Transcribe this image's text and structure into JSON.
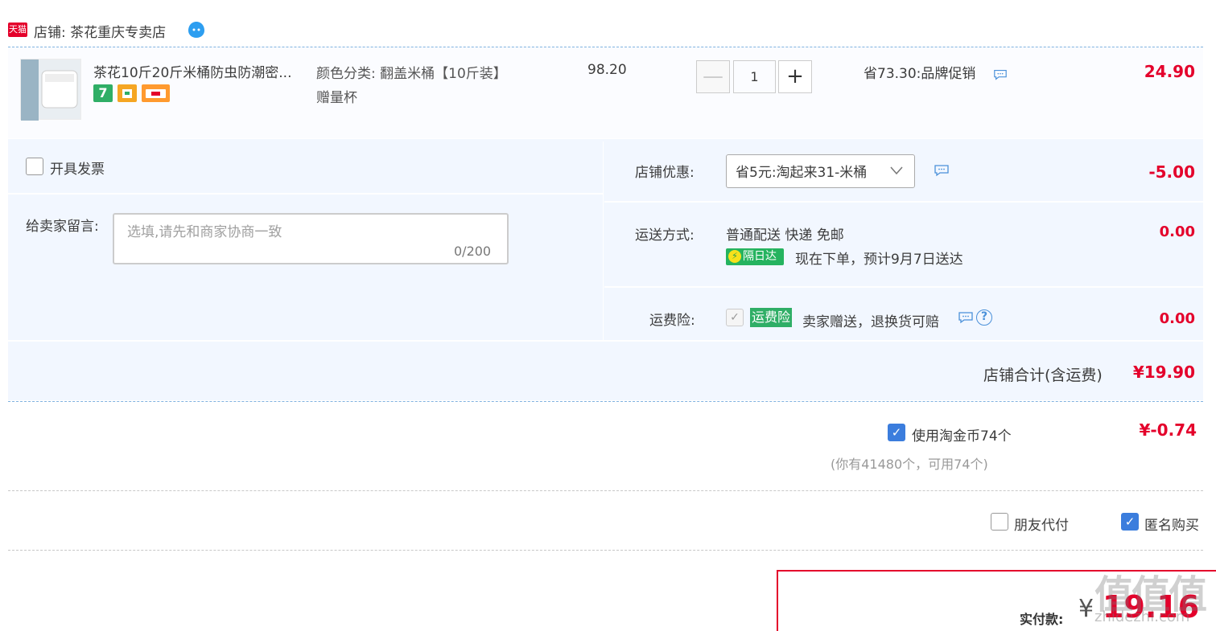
{
  "shop": {
    "badge": "天猫",
    "name": "店铺: 茶花重庆专卖店"
  },
  "item": {
    "title": "茶花10斤20斤米桶防虫防潮密...",
    "tag_seven": "7",
    "sku_line1": "颜色分类: 翻盖米桶【10斤装】",
    "sku_line2": "赠量杯",
    "price": "98.20",
    "quantity": "1",
    "minus": "—",
    "plus": "+",
    "promo": "省73.30:品牌促销",
    "total": "24.90"
  },
  "options": {
    "invoice_label": "开具发票",
    "message_label": "给卖家留言:",
    "message_placeholder": "选填,请先和商家协商一致",
    "message_count": "0/200",
    "coupon_label": "店铺优惠:",
    "coupon_value": "省5元:淘起来31-米桶",
    "coupon_amount": "-5.00",
    "shipping_label": "运送方式:",
    "shipping_value": "普通配送 快递 免邮",
    "express_badge": "隔日达",
    "shipping_eta": "现在下单，预计9月7日送达",
    "shipping_amount": "0.00",
    "insurance_label": "运费险:",
    "insurance_badge": "运费险",
    "insurance_text": "卖家赠送，退换货可赔",
    "insurance_amount": "0.00",
    "shop_total_label": "店铺合计(含运费)",
    "shop_total": "¥19.90"
  },
  "coins": {
    "label": "使用淘金币74个",
    "amount": "¥-0.74",
    "note": "(你有41480个，可用74个)"
  },
  "extras": {
    "friend_pay": "朋友代付",
    "anonymous": "匿名购买"
  },
  "payment": {
    "label": "实付款:",
    "currency": "¥",
    "amount": "19.16"
  },
  "watermark": {
    "text": "值值值",
    "sub": "zhidezhi.com"
  },
  "colors": {
    "accent_red": "#e4002b",
    "panel_bg": "#f2f7ff",
    "check_blue": "#3b7ddd",
    "badge_green": "#2fae66"
  }
}
